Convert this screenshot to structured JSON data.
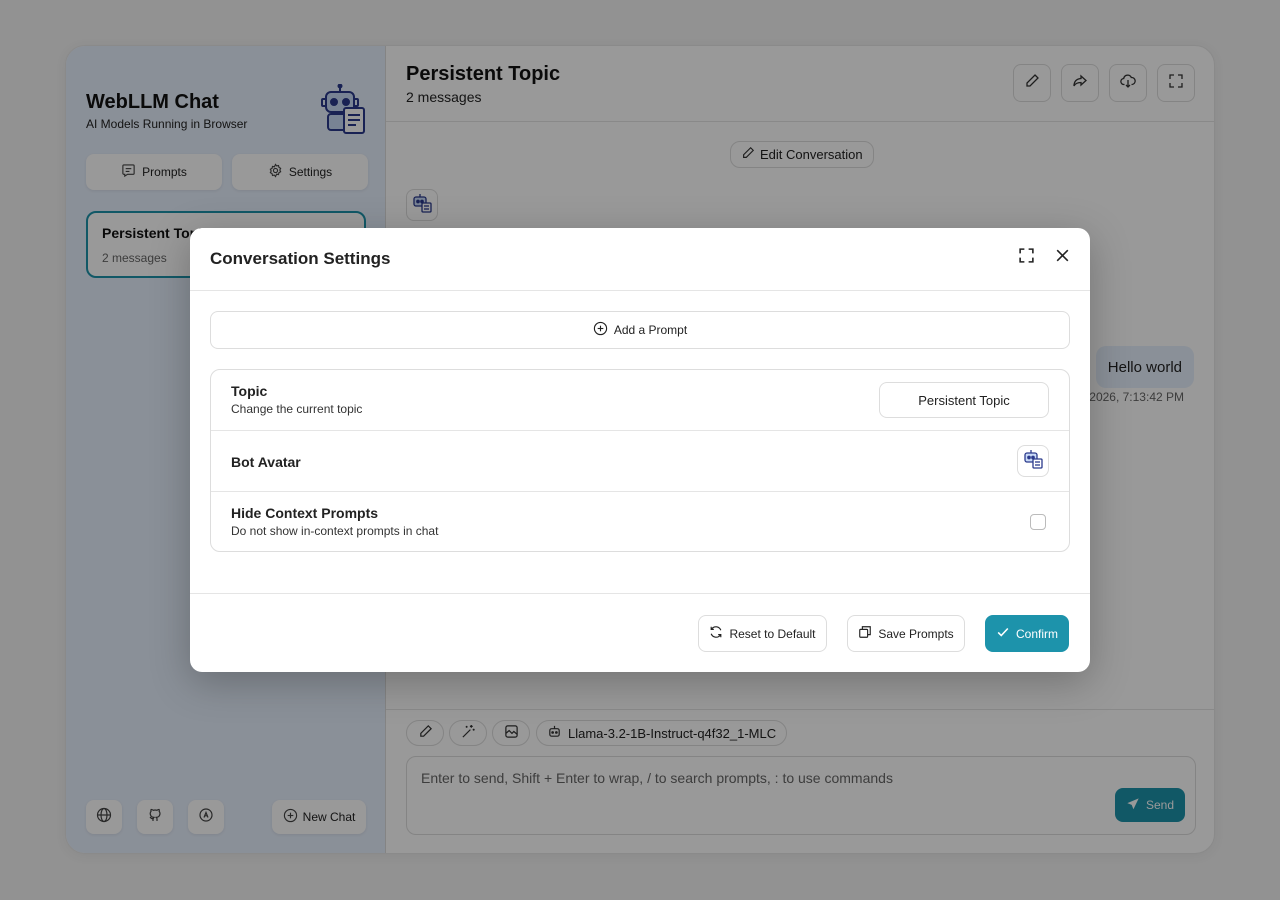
{
  "colors": {
    "accent": "#1d93ab",
    "sidebar_bg": "#e7f0fd",
    "overlay": "rgba(0,0,0,0.4)"
  },
  "sidebar": {
    "title": "WebLLM Chat",
    "subtitle": "AI Models Running in Browser",
    "logo_icon": "robot-document-icon",
    "prompts_label": "Prompts",
    "settings_label": "Settings",
    "chats": [
      {
        "title": "Persistent Topic",
        "count": "2 messages"
      }
    ],
    "bottom_icons": [
      "globe-icon",
      "github-icon",
      "model-refresh-icon"
    ],
    "new_chat_label": "New Chat"
  },
  "chat": {
    "title": "Persistent Topic",
    "subtitle": "2 messages",
    "header_icons": [
      "pencil-icon",
      "share-icon",
      "cloud-download-icon",
      "fullscreen-icon"
    ],
    "edit_label": "Edit Conversation",
    "user_message": "Hello world",
    "message_date": "2026, 7:13:42 PM",
    "model_name": "Llama-3.2-1B-Instruct-q4f32_1-MLC",
    "input_placeholder": "Enter to send, Shift + Enter to wrap, / to search prompts, : to use commands",
    "send_label": "Send"
  },
  "modal": {
    "title": "Conversation Settings",
    "add_prompt_label": "Add a Prompt",
    "rows": {
      "topic": {
        "title": "Topic",
        "subtitle": "Change the current topic",
        "value": "Persistent Topic"
      },
      "avatar": {
        "title": "Bot Avatar"
      },
      "hide": {
        "title": "Hide Context Prompts",
        "subtitle": "Do not show in-context prompts in chat",
        "checked": false
      }
    },
    "reset_label": "Reset to Default",
    "save_label": "Save Prompts",
    "confirm_label": "Confirm"
  }
}
